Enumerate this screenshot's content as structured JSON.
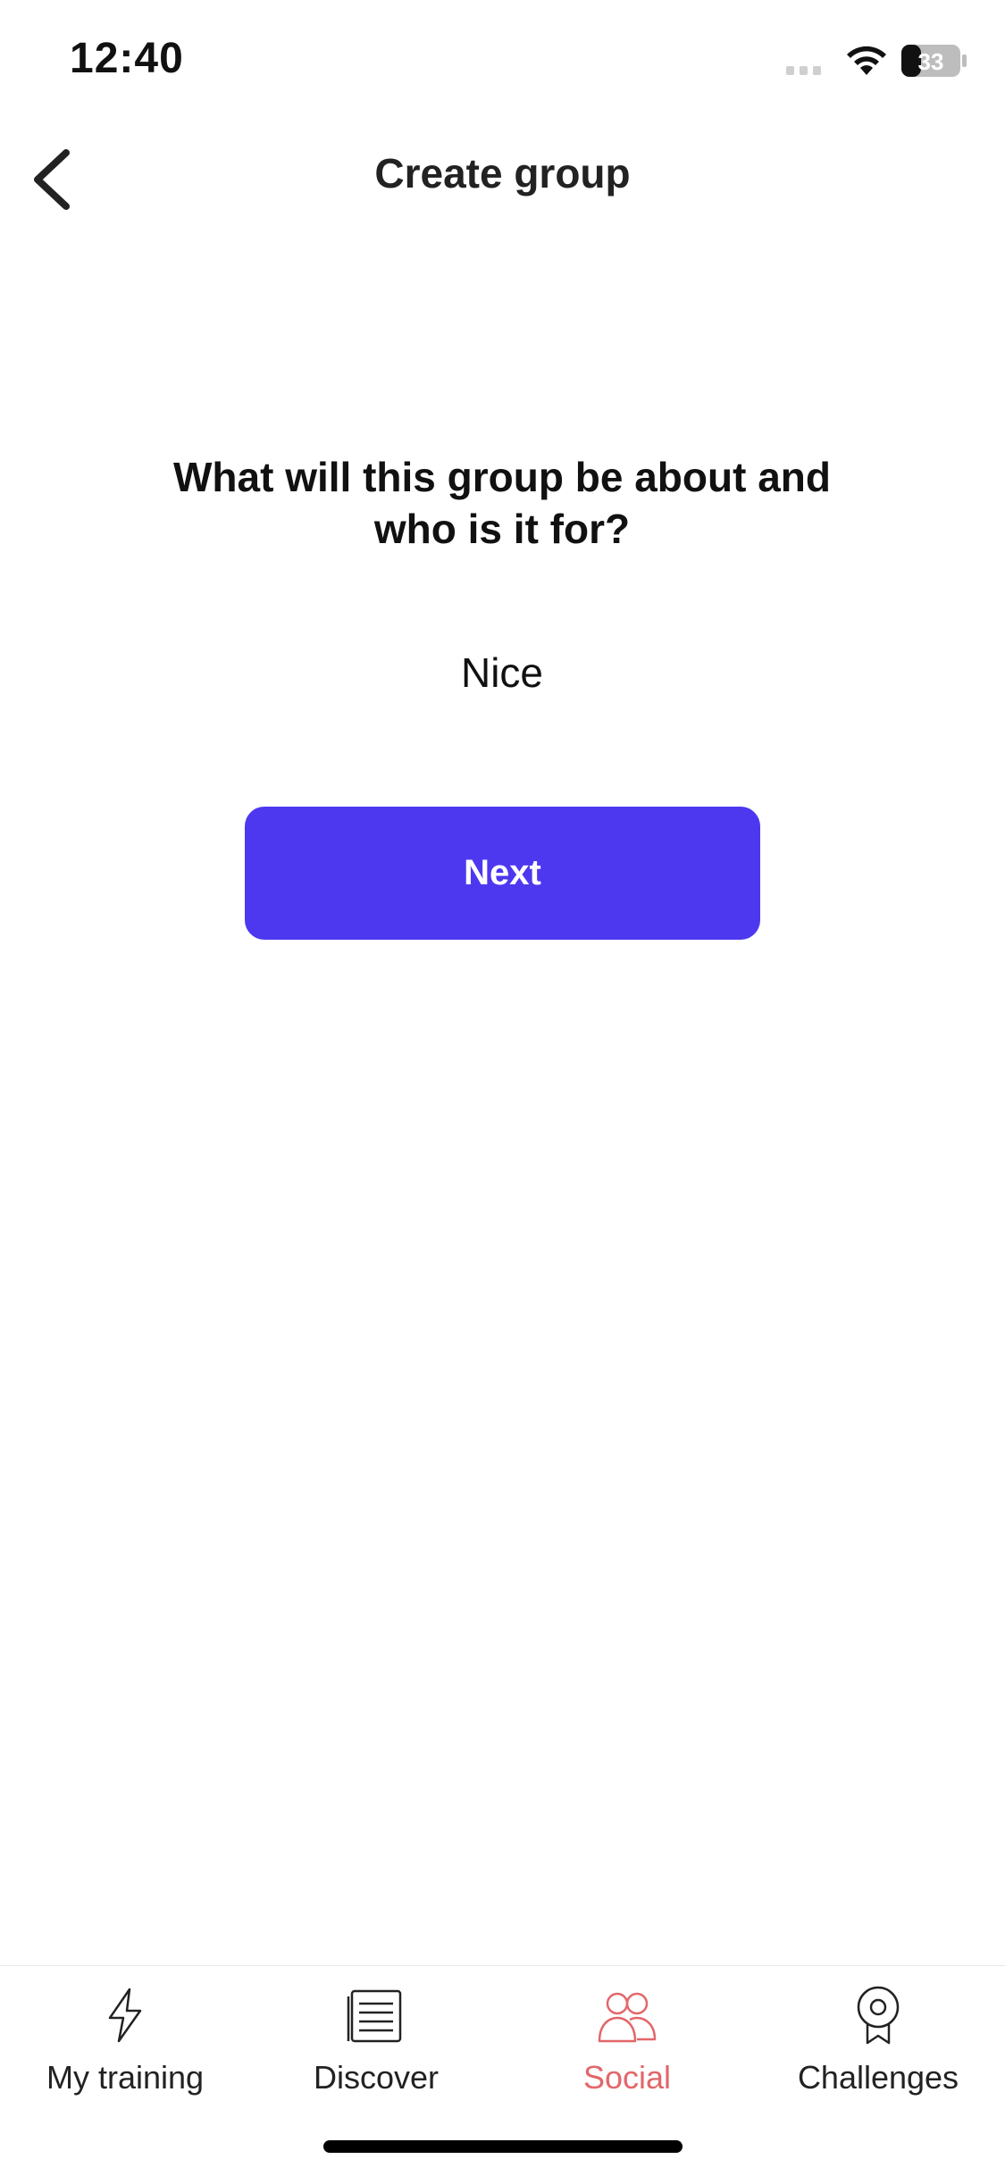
{
  "status_bar": {
    "time": "12:40",
    "battery_level": "33",
    "icons": [
      "signal-icon",
      "wifi-icon",
      "battery-icon"
    ]
  },
  "header": {
    "title": "Create group",
    "back_icon": "chevron-left-icon"
  },
  "main": {
    "question": "What will this group be about and who is it for?",
    "answer_value": "Nice",
    "next_label": "Next"
  },
  "tab_bar": {
    "active_color": "#e2676a",
    "items": [
      {
        "label": "My training",
        "icon": "lightning-icon",
        "active": false
      },
      {
        "label": "Discover",
        "icon": "document-icon",
        "active": false
      },
      {
        "label": "Social",
        "icon": "people-icon",
        "active": true
      },
      {
        "label": "Challenges",
        "icon": "medal-icon",
        "active": false
      }
    ]
  },
  "colors": {
    "primary_button": "#4d38f0",
    "text": "#111111"
  }
}
